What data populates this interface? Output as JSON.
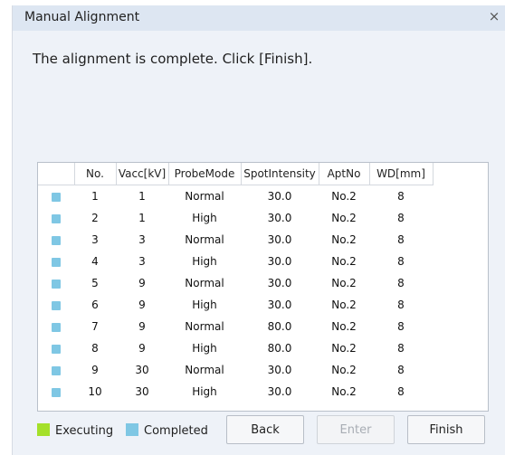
{
  "dialog": {
    "title": "Manual Alignment",
    "close_glyph": "×",
    "message": "The alignment is complete. Click [Finish]."
  },
  "table": {
    "columns": [
      "",
      "No.",
      "Vacc[kV]",
      "ProbeMode",
      "SpotIntensity",
      "AptNo",
      "WD[mm]"
    ],
    "rows": [
      {
        "status": "completed",
        "no": "1",
        "vacc": "1",
        "probe": "Normal",
        "spot": "30.0",
        "apt": "No.2",
        "wd": "8"
      },
      {
        "status": "completed",
        "no": "2",
        "vacc": "1",
        "probe": "High",
        "spot": "30.0",
        "apt": "No.2",
        "wd": "8"
      },
      {
        "status": "completed",
        "no": "3",
        "vacc": "3",
        "probe": "Normal",
        "spot": "30.0",
        "apt": "No.2",
        "wd": "8"
      },
      {
        "status": "completed",
        "no": "4",
        "vacc": "3",
        "probe": "High",
        "spot": "30.0",
        "apt": "No.2",
        "wd": "8"
      },
      {
        "status": "completed",
        "no": "5",
        "vacc": "9",
        "probe": "Normal",
        "spot": "30.0",
        "apt": "No.2",
        "wd": "8"
      },
      {
        "status": "completed",
        "no": "6",
        "vacc": "9",
        "probe": "High",
        "spot": "30.0",
        "apt": "No.2",
        "wd": "8"
      },
      {
        "status": "completed",
        "no": "7",
        "vacc": "9",
        "probe": "Normal",
        "spot": "80.0",
        "apt": "No.2",
        "wd": "8"
      },
      {
        "status": "completed",
        "no": "8",
        "vacc": "9",
        "probe": "High",
        "spot": "80.0",
        "apt": "No.2",
        "wd": "8"
      },
      {
        "status": "completed",
        "no": "9",
        "vacc": "30",
        "probe": "Normal",
        "spot": "30.0",
        "apt": "No.2",
        "wd": "8"
      },
      {
        "status": "completed",
        "no": "10",
        "vacc": "30",
        "probe": "High",
        "spot": "30.0",
        "apt": "No.2",
        "wd": "8"
      }
    ]
  },
  "legend": {
    "executing_label": "Executing",
    "completed_label": "Completed"
  },
  "buttons": {
    "back": "Back",
    "enter": "Enter",
    "finish": "Finish"
  },
  "colors": {
    "executing": "#a4e02a",
    "completed": "#7fc7e4"
  }
}
